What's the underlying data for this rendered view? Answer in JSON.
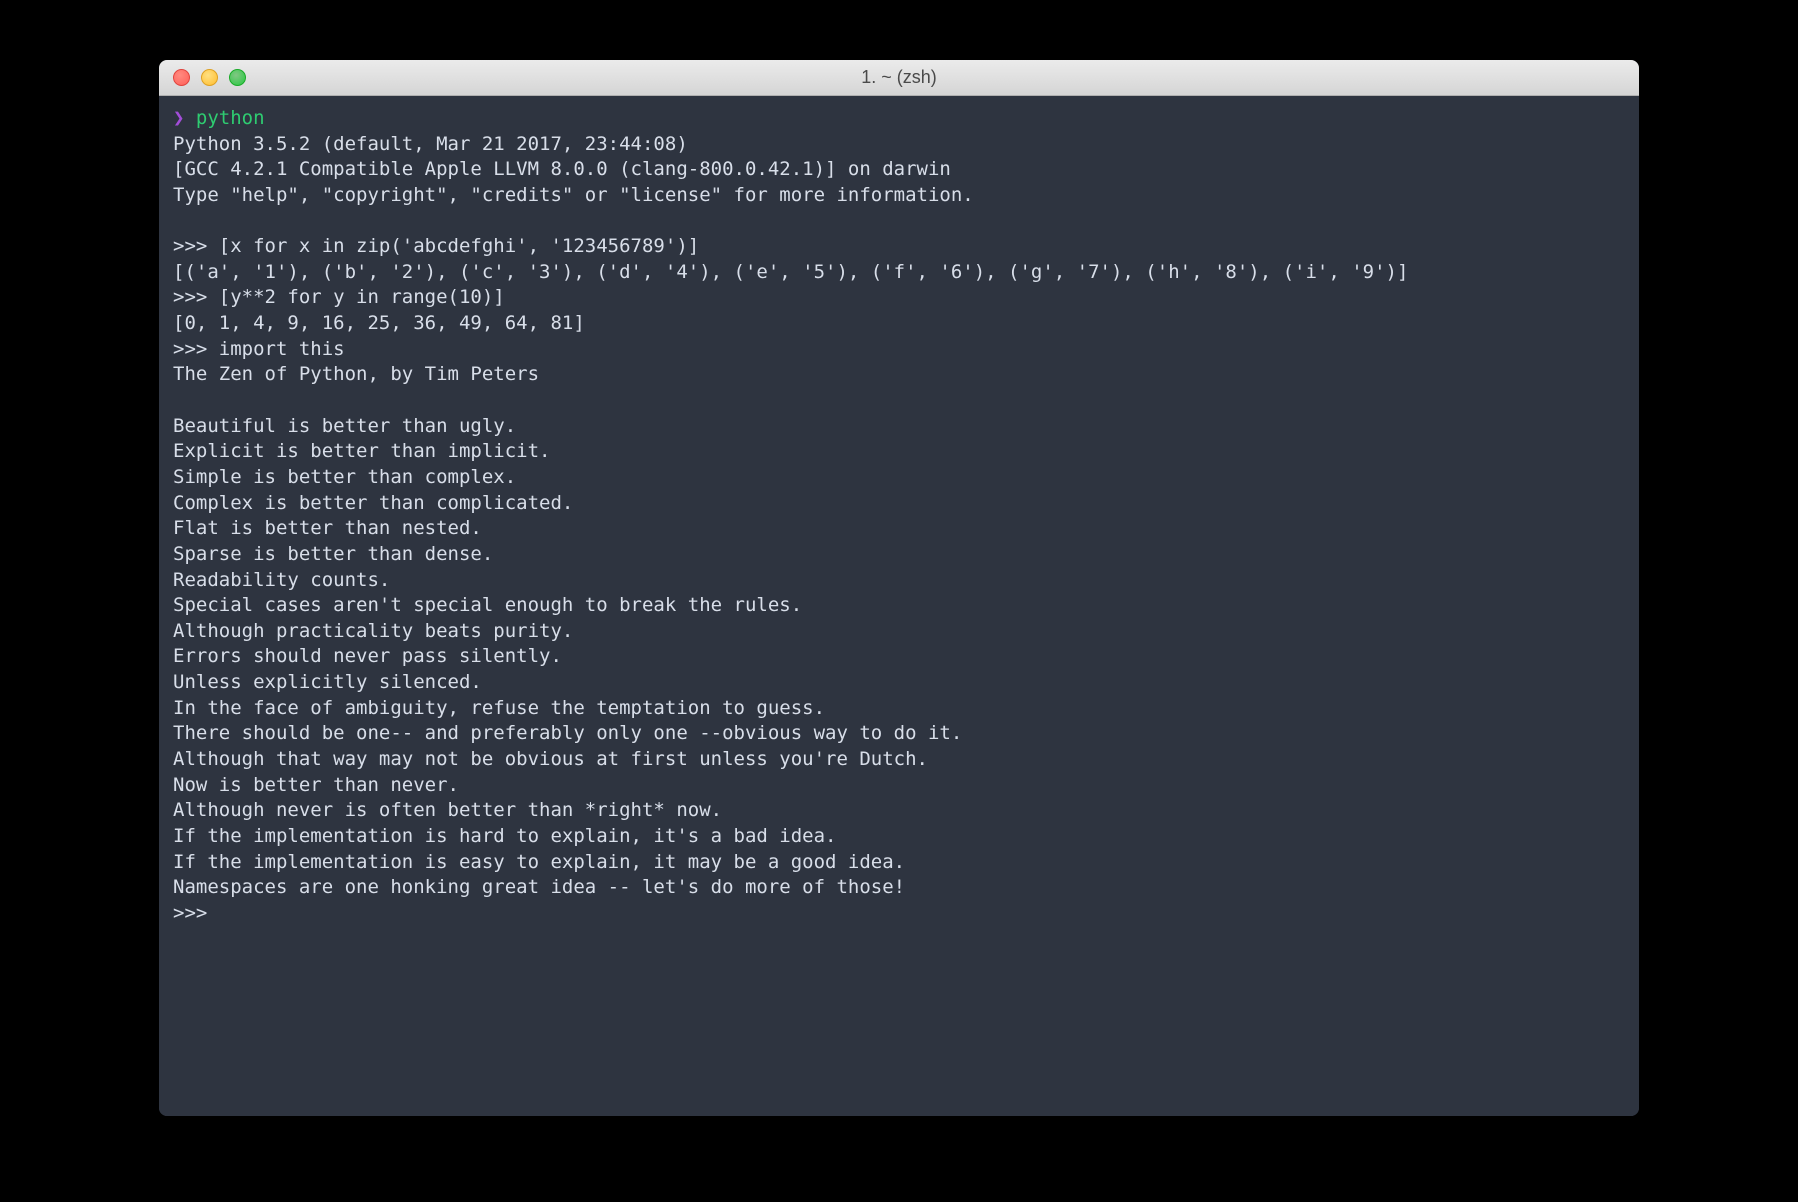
{
  "window": {
    "title": "1. ~ (zsh)"
  },
  "prompt": {
    "arrow": "❯",
    "command": "python"
  },
  "terminal": {
    "lines": [
      "Python 3.5.2 (default, Mar 21 2017, 23:44:08)",
      "[GCC 4.2.1 Compatible Apple LLVM 8.0.0 (clang-800.0.42.1)] on darwin",
      "Type \"help\", \"copyright\", \"credits\" or \"license\" for more information.",
      "",
      ">>> [x for x in zip('abcdefghi', '123456789')]",
      "[('a', '1'), ('b', '2'), ('c', '3'), ('d', '4'), ('e', '5'), ('f', '6'), ('g', '7'), ('h', '8'), ('i', '9')]",
      ">>> [y**2 for y in range(10)]",
      "[0, 1, 4, 9, 16, 25, 36, 49, 64, 81]",
      ">>> import this",
      "The Zen of Python, by Tim Peters",
      "",
      "Beautiful is better than ugly.",
      "Explicit is better than implicit.",
      "Simple is better than complex.",
      "Complex is better than complicated.",
      "Flat is better than nested.",
      "Sparse is better than dense.",
      "Readability counts.",
      "Special cases aren't special enough to break the rules.",
      "Although practicality beats purity.",
      "Errors should never pass silently.",
      "Unless explicitly silenced.",
      "In the face of ambiguity, refuse the temptation to guess.",
      "There should be one-- and preferably only one --obvious way to do it.",
      "Although that way may not be obvious at first unless you're Dutch.",
      "Now is better than never.",
      "Although never is often better than *right* now.",
      "If the implementation is hard to explain, it's a bad idea.",
      "If the implementation is easy to explain, it may be a good idea.",
      "Namespaces are one honking great idea -- let's do more of those!",
      ">>>"
    ]
  }
}
